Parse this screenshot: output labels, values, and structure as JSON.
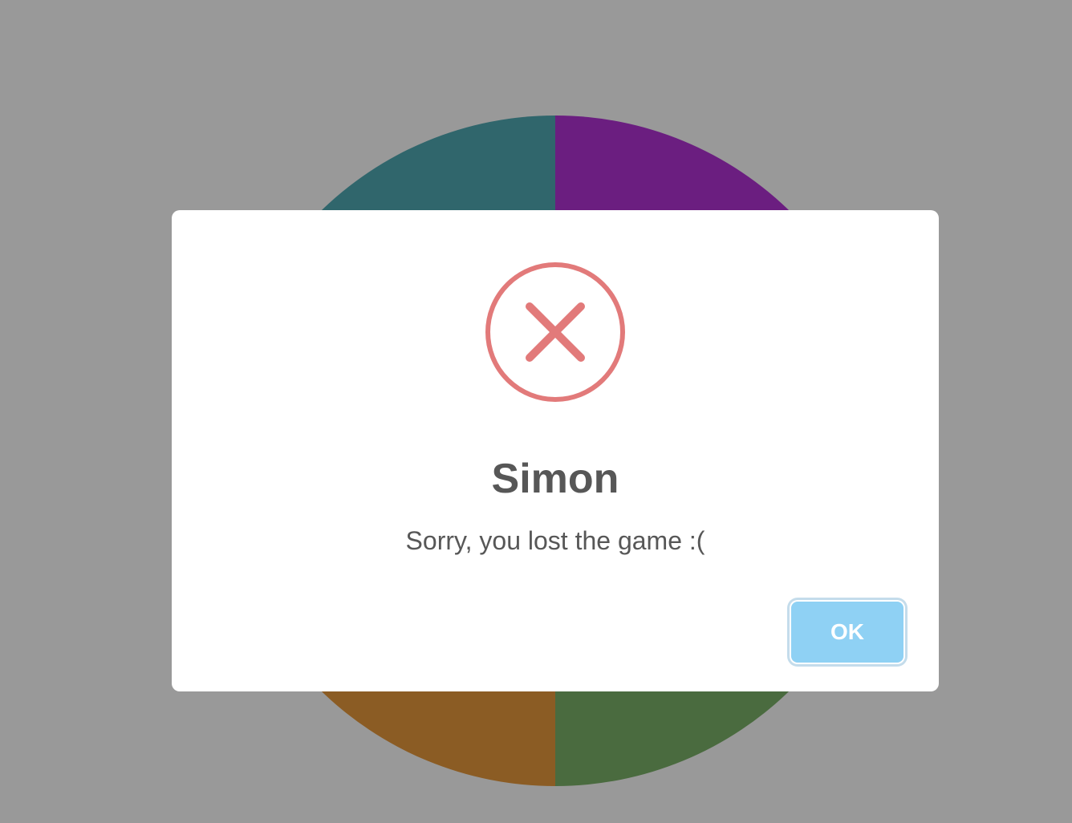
{
  "game": {
    "pads": [
      {
        "name": "teal",
        "color": "#51aab4"
      },
      {
        "name": "purple",
        "color": "#b232d6"
      },
      {
        "name": "orange",
        "color": "#e89a3c"
      },
      {
        "name": "green",
        "color": "#7cb26a"
      }
    ]
  },
  "modal": {
    "icon": "error-x-icon",
    "icon_color": "#e27a7a",
    "title": "Simon",
    "text": "Sorry, you lost the game :(",
    "confirm_label": "OK",
    "confirm_color": "#8fd1f4"
  }
}
